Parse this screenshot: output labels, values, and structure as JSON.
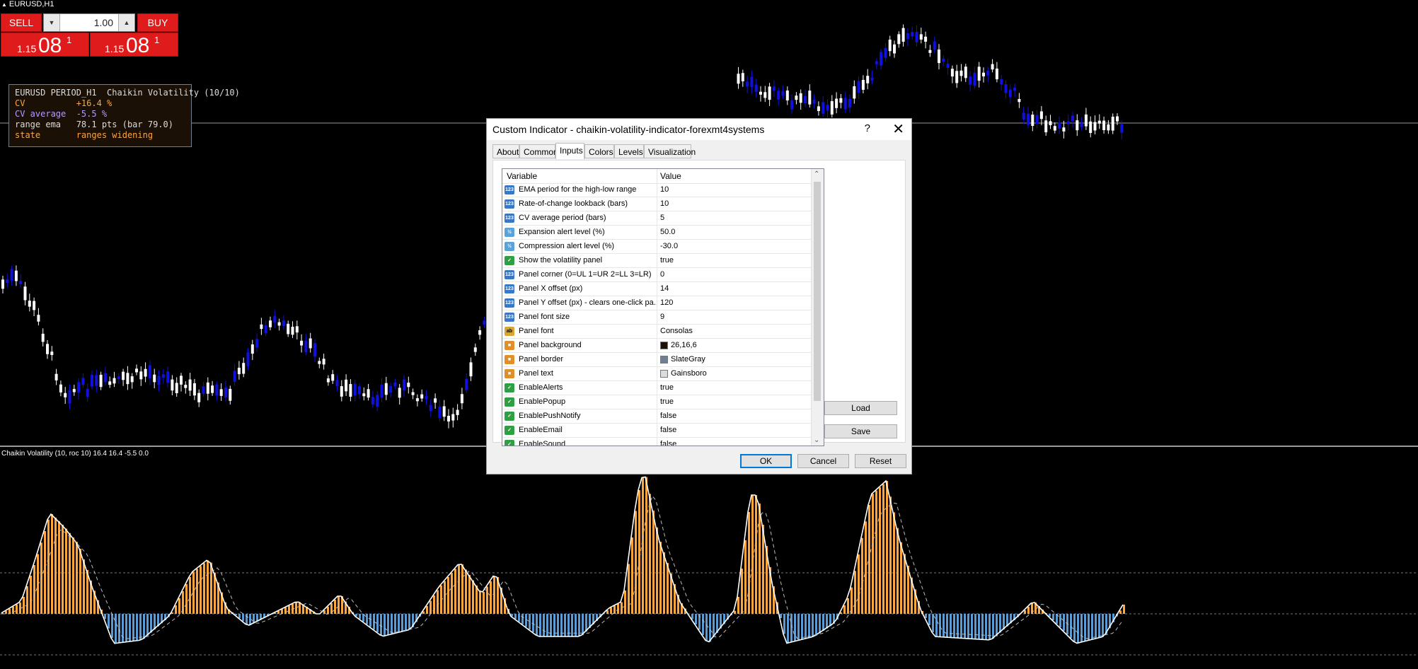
{
  "window": {
    "symbol": "EURUSD,H1"
  },
  "one_click": {
    "sell_label": "SELL",
    "buy_label": "BUY",
    "lot_value": "1.00",
    "sell_price": {
      "small": "1.15",
      "big": "08",
      "sup": "1"
    },
    "buy_price": {
      "small": "1.15",
      "big": "08",
      "sup": "1"
    }
  },
  "info_panel": {
    "line1": "EURUSD PERIOD_H1  Chaikin Volatility (10/10)",
    "cv_label": "CV          ",
    "cv_value": "+16.4 %",
    "cva_label": "CV average  ",
    "cva_value": "-5.5 %",
    "range_label": "range ema   ",
    "range_value": "78.1 pts (bar 79.0)",
    "state_label": "state       ",
    "state_value": "ranges widening"
  },
  "subwindow": {
    "title": "Chaikin Volatility (10, roc 10) 16.4 16.4 -5.5 0.0"
  },
  "dialog": {
    "title": "Custom Indicator - chaikin-volatility-indicator-forexmt4systems",
    "help": "?",
    "close": "✕",
    "tabs": [
      "About",
      "Common",
      "Inputs",
      "Colors",
      "Levels",
      "Visualization"
    ],
    "active_tab": "Inputs",
    "columns": {
      "variable": "Variable",
      "value": "Value"
    },
    "rows": [
      {
        "type": "num",
        "icon": "123",
        "name": "EMA period for the high-low range",
        "value": "10"
      },
      {
        "type": "num",
        "icon": "123",
        "name": "Rate-of-change lookback (bars)",
        "value": "10"
      },
      {
        "type": "num",
        "icon": "123",
        "name": "CV average period (bars)",
        "value": "5"
      },
      {
        "type": "dbl",
        "icon": "½",
        "name": "Expansion alert level (%)",
        "value": "50.0"
      },
      {
        "type": "dbl",
        "icon": "½",
        "name": "Compression alert level (%)",
        "value": "-30.0"
      },
      {
        "type": "bool",
        "icon": "✓",
        "name": "Show the volatility panel",
        "value": "true"
      },
      {
        "type": "num",
        "icon": "123",
        "name": "Panel corner (0=UL 1=UR 2=LL 3=LR)",
        "value": "0"
      },
      {
        "type": "num",
        "icon": "123",
        "name": "Panel X offset (px)",
        "value": "14"
      },
      {
        "type": "num",
        "icon": "123",
        "name": "Panel Y offset (px) - clears one-click pa...",
        "value": "120"
      },
      {
        "type": "num",
        "icon": "123",
        "name": "Panel font size",
        "value": "9"
      },
      {
        "type": "str",
        "icon": "ab",
        "name": "Panel font",
        "value": "Consolas"
      },
      {
        "type": "col",
        "icon": "■",
        "name": "Panel background",
        "value": "26,16,6",
        "swatch": "#1a1006"
      },
      {
        "type": "col",
        "icon": "■",
        "name": "Panel border",
        "value": "SlateGray",
        "swatch": "#708090"
      },
      {
        "type": "col",
        "icon": "■",
        "name": "Panel text",
        "value": "Gainsboro",
        "swatch": "#dcdcdc"
      },
      {
        "type": "bool",
        "icon": "✓",
        "name": "EnableAlerts",
        "value": "true"
      },
      {
        "type": "bool",
        "icon": "✓",
        "name": "EnablePopup",
        "value": "true"
      },
      {
        "type": "bool",
        "icon": "✓",
        "name": "EnablePushNotify",
        "value": "false"
      },
      {
        "type": "bool",
        "icon": "✓",
        "name": "EnableEmail",
        "value": "false"
      },
      {
        "type": "bool",
        "icon": "✓",
        "name": "EnableSound",
        "value": "false"
      }
    ],
    "buttons": {
      "load": "Load",
      "save": "Save",
      "ok": "OK",
      "cancel": "Cancel",
      "reset": "Reset"
    }
  },
  "colors": {
    "bull": "#1010e0",
    "bear": "#ffffff",
    "hist_pos": "#ffa53a",
    "hist_neg": "#5b9bd5"
  }
}
